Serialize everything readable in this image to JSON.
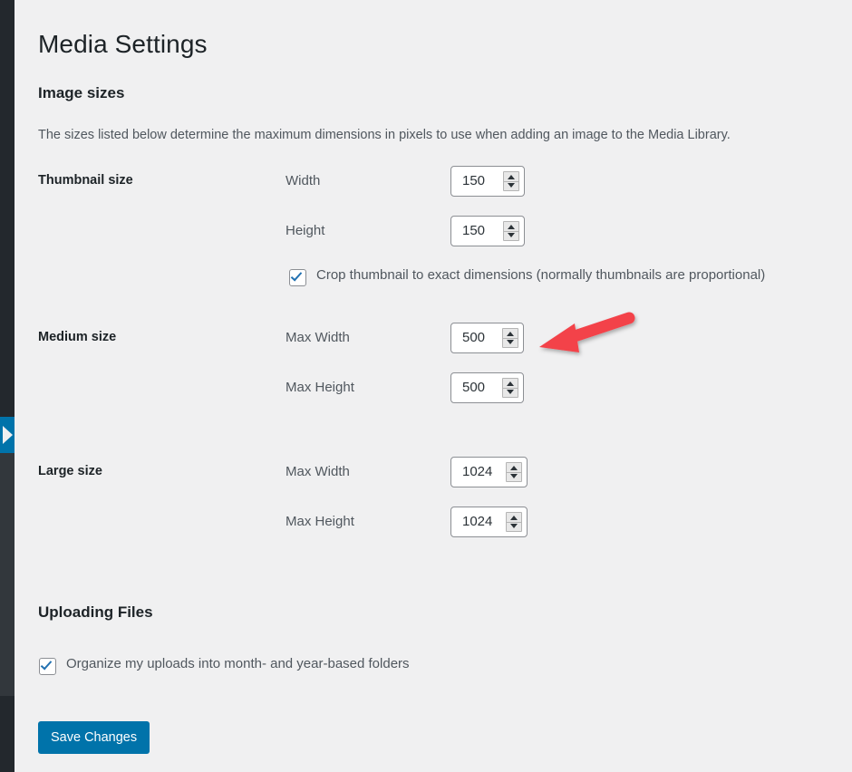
{
  "page": {
    "title": "Media Settings"
  },
  "sections": {
    "image_sizes": {
      "heading": "Image sizes",
      "description": "The sizes listed below determine the maximum dimensions in pixels to use when adding an image to the Media Library.",
      "rows": [
        {
          "label": "Thumbnail size",
          "fields": [
            {
              "label": "Width",
              "value": "150"
            },
            {
              "label": "Height",
              "value": "150"
            }
          ],
          "checkbox": {
            "label": "Crop thumbnail to exact dimensions (normally thumbnails are proportional)",
            "checked": true
          }
        },
        {
          "label": "Medium size",
          "fields": [
            {
              "label": "Max Width",
              "value": "500"
            },
            {
              "label": "Max Height",
              "value": "500"
            }
          ]
        },
        {
          "label": "Large size",
          "fields": [
            {
              "label": "Max Width",
              "value": "1024"
            },
            {
              "label": "Max Height",
              "value": "1024"
            }
          ]
        }
      ]
    },
    "uploading_files": {
      "heading": "Uploading Files",
      "checkbox": {
        "label": "Organize my uploads into month- and year-based folders",
        "checked": true
      }
    }
  },
  "actions": {
    "save_label": "Save Changes"
  },
  "sidebar": {
    "collapse_icon": "chevron-left-icon"
  },
  "annotation": {
    "type": "arrow",
    "color": "#f3434a",
    "points_to": "Medium size Max Width field"
  },
  "colors": {
    "accent": "#0073aa",
    "checkbox_tick": "#2271b1",
    "sidebar_dark": "#23282d",
    "sidebar_light": "#32373c",
    "page_background": "#f0f0f1",
    "arrow_red": "#f3434a"
  }
}
